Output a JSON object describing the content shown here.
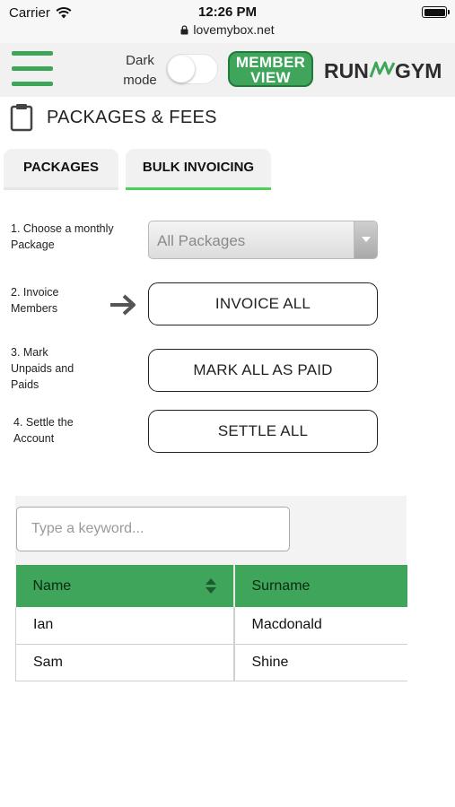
{
  "status_bar": {
    "carrier": "Carrier",
    "time": "12:26 PM",
    "url": "lovemybox.net"
  },
  "header": {
    "dark_mode_label": "Dark mode",
    "dark_mode_on": false,
    "member_view_label": "MEMBER VIEW",
    "logo_text": "RUNMYGYM",
    "brand_color": "#3ea55a"
  },
  "page": {
    "title": "PACKAGES & FEES"
  },
  "tabs": [
    {
      "label": "PACKAGES",
      "active": false
    },
    {
      "label": "BULK INVOICING",
      "active": true
    }
  ],
  "steps": [
    {
      "label": "1. Choose a monthly Package"
    },
    {
      "label": "2. Invoice Members"
    },
    {
      "label": "3. Mark Unpaids and Paids"
    },
    {
      "label": "4. Settle the Account"
    }
  ],
  "package_select": {
    "selected": "All Packages"
  },
  "actions": {
    "invoice_all": "INVOICE ALL",
    "mark_all_paid": "MARK ALL AS PAID",
    "settle_all": "SETTLE ALL"
  },
  "search": {
    "placeholder": "Type a keyword..."
  },
  "members_table": {
    "columns": [
      "Name",
      "Surname"
    ],
    "rows": [
      [
        "Ian",
        "Macdonald"
      ],
      [
        "Sam",
        "Shine"
      ]
    ]
  }
}
